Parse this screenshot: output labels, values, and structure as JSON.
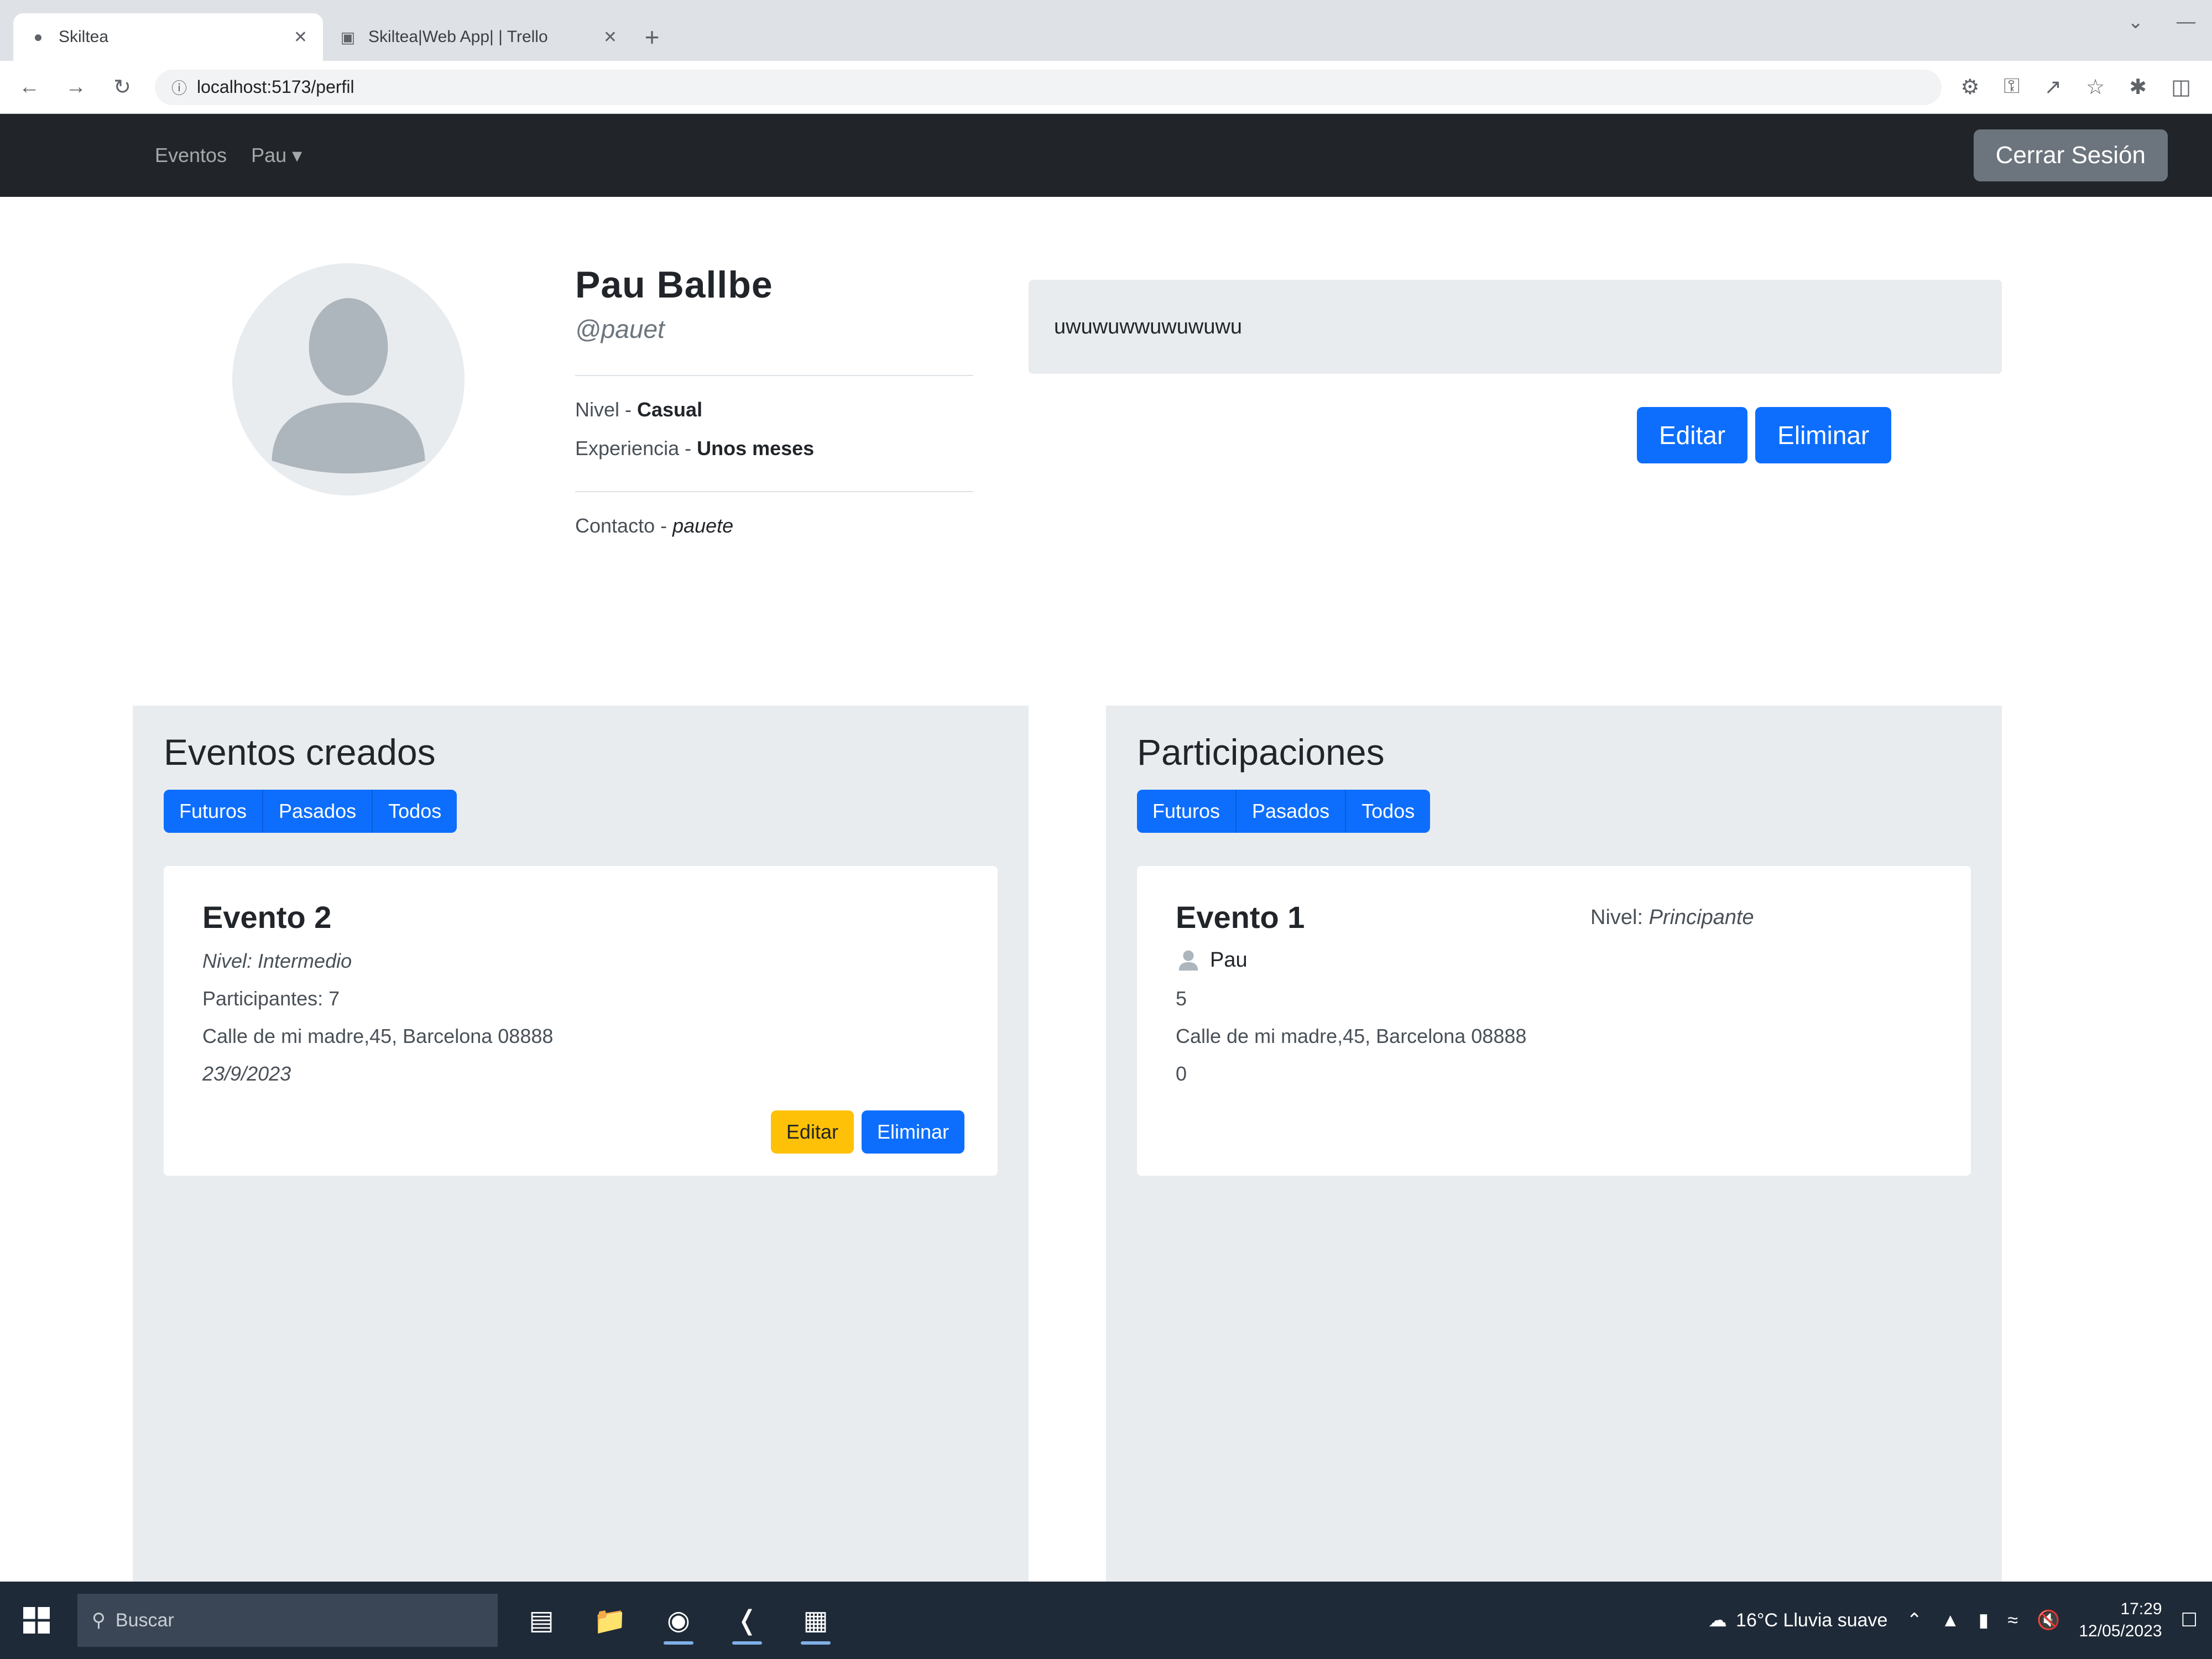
{
  "browser": {
    "tabs": [
      {
        "title": "Skiltea",
        "active": true
      },
      {
        "title": "Skiltea|Web App| | Trello",
        "active": false
      }
    ],
    "new_tab": "+",
    "url": "localhost:5173/perfil"
  },
  "navbar": {
    "links": [
      "Eventos",
      "Pau"
    ],
    "logout_label": "Cerrar Sesión"
  },
  "profile": {
    "name": "Pau Ballbe",
    "username": "@pauet",
    "level_label": "Nivel - ",
    "level_value": "Casual",
    "experience_label": "Experiencia - ",
    "experience_value": "Unos meses",
    "contact_label": "Contacto - ",
    "contact_value": "pauete",
    "bio": "uwuwuwwuwuwuwu",
    "edit_label": "Editar",
    "delete_label": "Eliminar"
  },
  "created_events": {
    "title": "Eventos creados",
    "filters": [
      "Futuros",
      "Pasados",
      "Todos"
    ],
    "event": {
      "name": "Evento 2",
      "level": "Nivel: Intermedio",
      "participants": "Participantes: 7",
      "address": "Calle de mi madre,45, Barcelona 08888",
      "date": "23/9/2023",
      "edit_label": "Editar",
      "delete_label": "Eliminar"
    }
  },
  "participations": {
    "title": "Participaciones",
    "filters": [
      "Futuros",
      "Pasados",
      "Todos"
    ],
    "event": {
      "name": "Evento 1",
      "level_label": "Nivel: ",
      "level_value": "Principante",
      "participant": "Pau",
      "count": "5",
      "address": "Calle de mi madre,45, Barcelona 08888",
      "extra": "0"
    }
  },
  "taskbar": {
    "search_placeholder": "Buscar",
    "weather": "16°C  Lluvia suave",
    "time": "17:29",
    "date": "12/05/2023"
  },
  "colors": {
    "primary": "#0d6efd",
    "warning": "#ffc107",
    "navbar": "#212529",
    "secondary": "#6c757d"
  }
}
